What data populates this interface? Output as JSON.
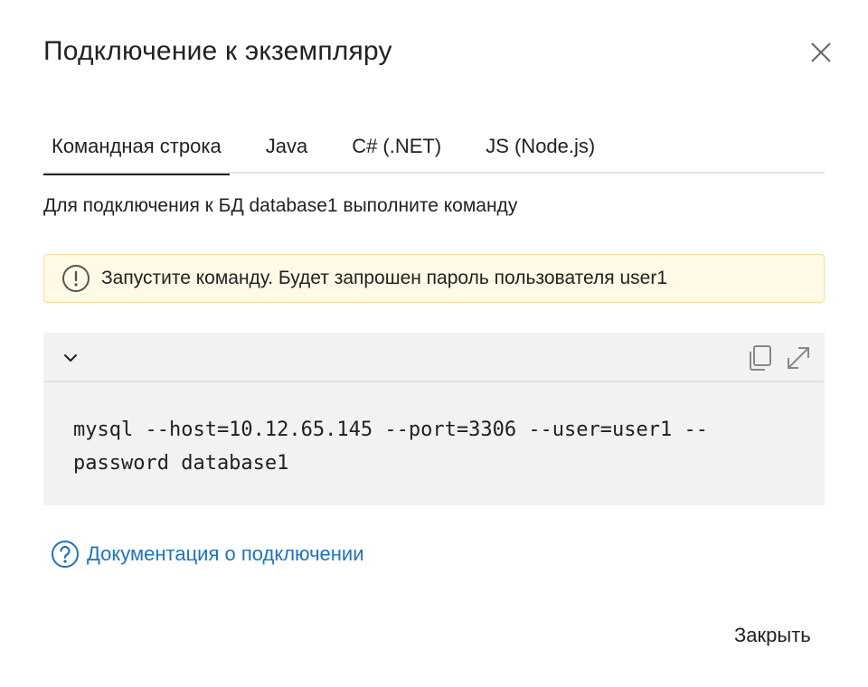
{
  "dialog": {
    "title": "Подключение к экземпляру"
  },
  "tabs": [
    {
      "label": "Командная строка",
      "active": true
    },
    {
      "label": "Java",
      "active": false
    },
    {
      "label": "C# (.NET)",
      "active": false
    },
    {
      "label": "JS (Node.js)",
      "active": false
    }
  ],
  "description": "Для подключения к БД database1 выполните команду",
  "alert": {
    "icon": "warning-circle-icon",
    "text": "Запустите команду. Будет запрошен пароль пользователя user1"
  },
  "code": {
    "command": "mysql --host=10.12.65.145 --port=3306 --user=user1 --password database1"
  },
  "doc_link": {
    "icon": "help-circle-icon",
    "label": "Документация о подключении"
  },
  "footer": {
    "close_label": "Закрыть"
  },
  "colors": {
    "link": "#1a73c8",
    "alert_bg": "#fff9e6",
    "alert_border": "#f5dc9c",
    "code_bg": "#f2f2f2"
  }
}
